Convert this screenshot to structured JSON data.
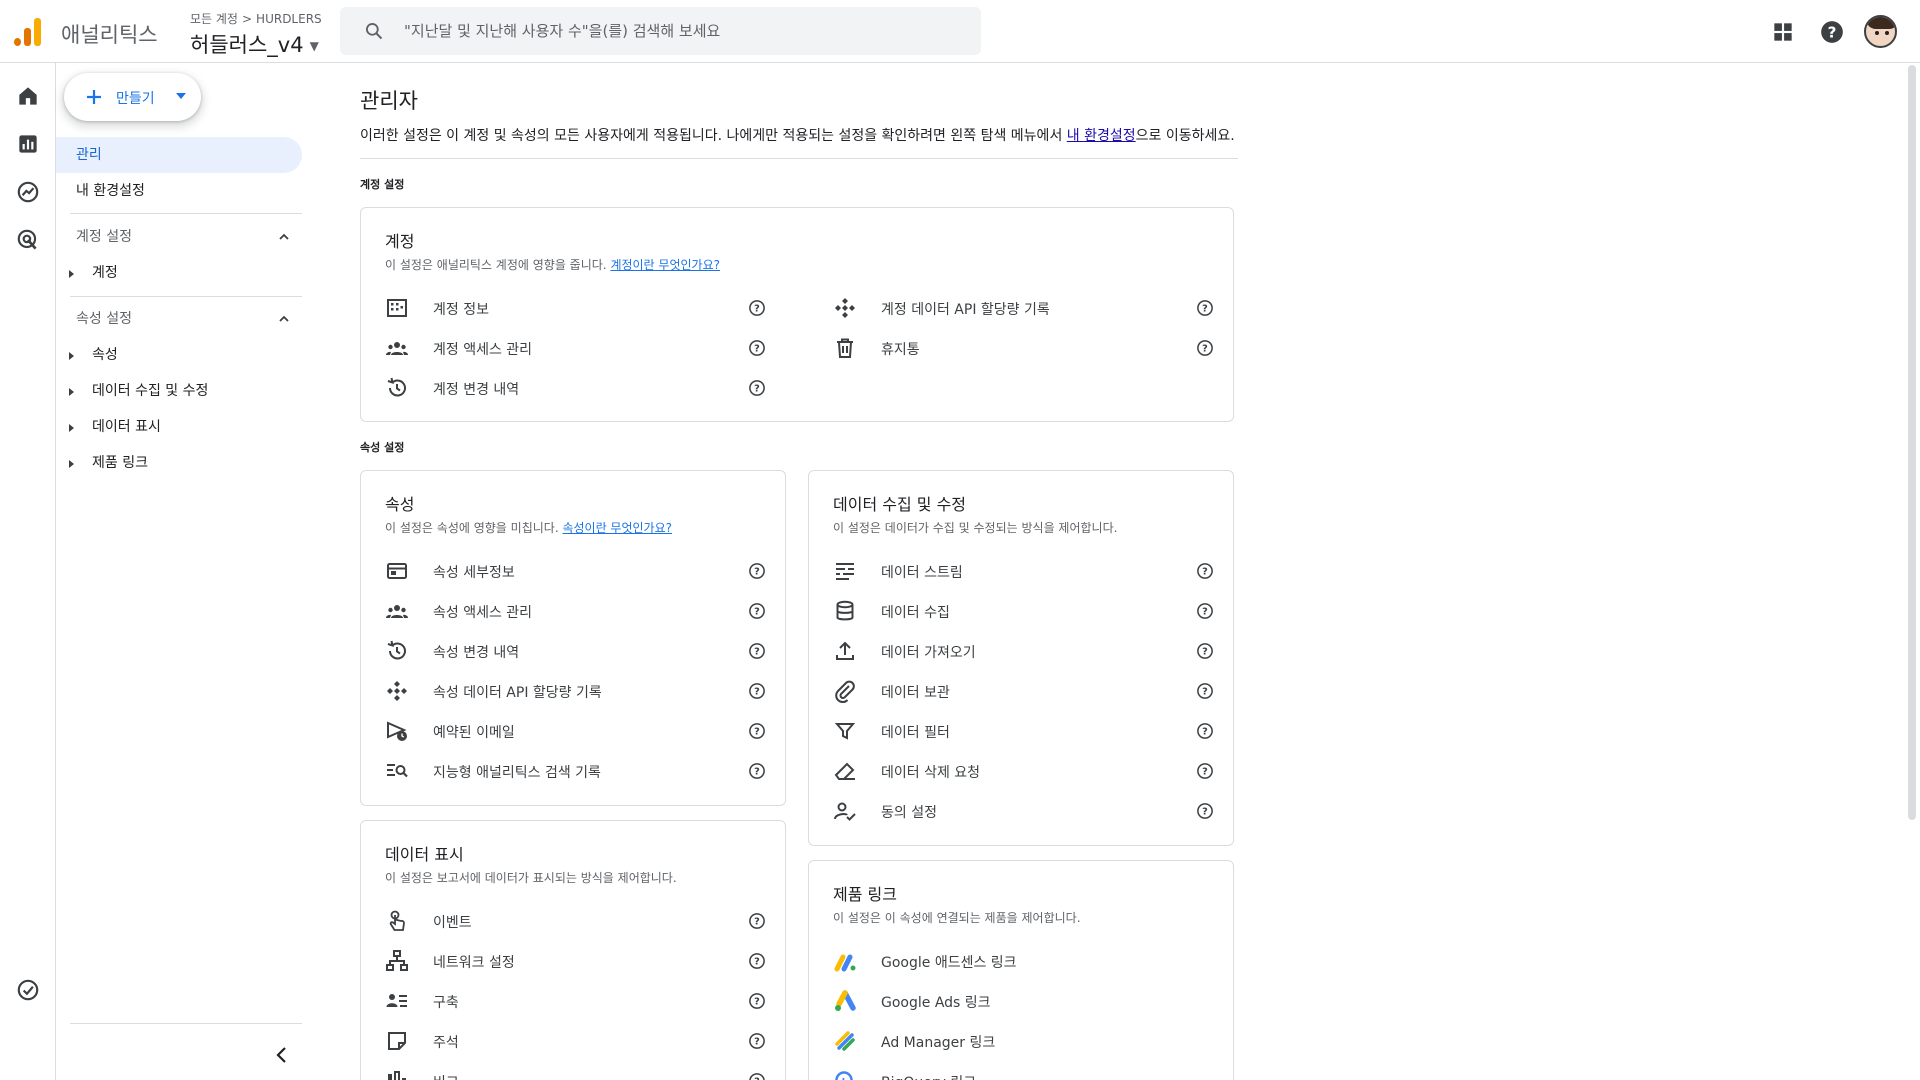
{
  "app": {
    "product_name": "애널리틱스",
    "breadcrumb_root": "모든 계정",
    "breadcrumb_sep": ">",
    "breadcrumb_account": "HURDLERS",
    "property_name": "허들러스_v4"
  },
  "search": {
    "placeholder": "\"지난달 및 지난해 사용자 수\"을(를) 검색해 보세요"
  },
  "topbar_icons": [
    "apps-grid-icon",
    "help-icon",
    "avatar"
  ],
  "rail": [
    "home-icon",
    "reports-icon",
    "explore-icon",
    "advertising-icon",
    "tasks-icon",
    "admin-gear-icon"
  ],
  "sidenav": {
    "create_label": "만들기",
    "items": [
      "관리",
      "내 환경설정"
    ],
    "account_section": "계정 설정",
    "account_children": [
      "계정"
    ],
    "property_section": "속성 설정",
    "property_children": [
      "속성",
      "데이터 수집 및 수정",
      "데이터 표시",
      "제품 링크"
    ]
  },
  "page": {
    "title": "관리자",
    "desc_before": "이러한 설정은 이 계정 및 속성의 모든 사용자에게 적용됩니다. 나에게만 적용되는 설정을 확인하려면 왼쪽 탐색 메뉴에서 ",
    "desc_link": "내 환경설정",
    "desc_after": "으로 이동하세요.",
    "account_header": "계정 설정",
    "property_header": "속성 설정"
  },
  "account_card": {
    "title": "계정",
    "desc": "이 설정은 애널리틱스 계정에 영향을 줍니다. ",
    "desc_link": "계정이란 무엇인가요?",
    "left": [
      {
        "label": "계정 정보",
        "icon": "building-icon"
      },
      {
        "label": "계정 액세스 관리",
        "icon": "people-icon"
      },
      {
        "label": "계정 변경 내역",
        "icon": "history-icon"
      }
    ],
    "right": [
      {
        "label": "계정 데이터 API 할당량 기록",
        "icon": "api-icon"
      },
      {
        "label": "휴지통",
        "icon": "trash-icon"
      }
    ]
  },
  "property_card": {
    "title": "속성",
    "desc": "이 설정은 속성에 영향을 미칩니다. ",
    "desc_link": "속성이란 무엇인가요?",
    "rows": [
      {
        "label": "속성 세부정보",
        "icon": "details-icon"
      },
      {
        "label": "속성 액세스 관리",
        "icon": "people-icon"
      },
      {
        "label": "속성 변경 내역",
        "icon": "history-icon"
      },
      {
        "label": "속성 데이터 API 할당량 기록",
        "icon": "api-icon"
      },
      {
        "label": "예약된 이메일",
        "icon": "scheduled-email-icon"
      },
      {
        "label": "지능형 애널리틱스 검색 기록",
        "icon": "search-history-icon"
      }
    ]
  },
  "collection_card": {
    "title": "데이터 수집 및 수정",
    "desc": "이 설정은 데이터가 수집 및 수정되는 방식을 제어합니다.",
    "rows": [
      {
        "label": "데이터 스트림",
        "icon": "stream-icon"
      },
      {
        "label": "데이터 수집",
        "icon": "database-icon"
      },
      {
        "label": "데이터 가져오기",
        "icon": "upload-icon"
      },
      {
        "label": "데이터 보관",
        "icon": "retention-icon"
      },
      {
        "label": "데이터 필터",
        "icon": "filter-icon"
      },
      {
        "label": "데이터 삭제 요청",
        "icon": "eraser-icon"
      },
      {
        "label": "동의 설정",
        "icon": "consent-icon"
      }
    ]
  },
  "display_card": {
    "title": "데이터 표시",
    "desc": "이 설정은 보고서에 데이터가 표시되는 방식을 제어합니다.",
    "rows": [
      {
        "label": "이벤트",
        "icon": "touch-icon"
      },
      {
        "label": "네트워크 설정",
        "icon": "network-icon"
      },
      {
        "label": "구축",
        "icon": "audience-icon"
      },
      {
        "label": "주석",
        "icon": "note-icon"
      },
      {
        "label": "비교",
        "icon": "compare-icon"
      }
    ]
  },
  "links_card": {
    "title": "제품 링크",
    "desc": "이 설정은 이 속성에 연결되는 제품을 제어합니다.",
    "rows": [
      {
        "label": "Google 애드센스 링크",
        "icon": "adsense-icon"
      },
      {
        "label": "Google Ads 링크",
        "icon": "google-ads-icon"
      },
      {
        "label": "Ad Manager 링크",
        "icon": "ad-manager-icon"
      },
      {
        "label": "BigQuery 링크",
        "icon": "bigquery-icon"
      }
    ]
  },
  "colors": {
    "accent": "#1a73e8",
    "active_bg": "#e8f0fe",
    "border": "#dadce0",
    "text_secondary": "#5f6368"
  }
}
